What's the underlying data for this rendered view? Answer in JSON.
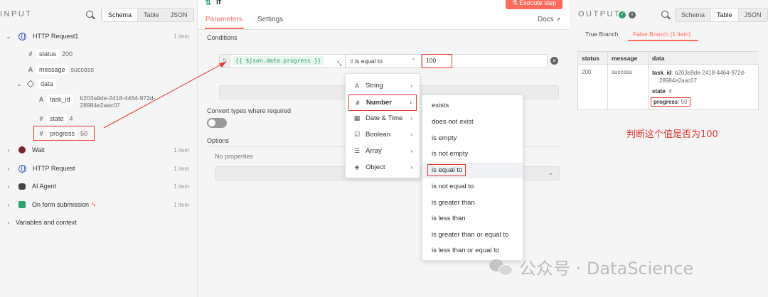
{
  "input": {
    "title": "INPUT",
    "view_tabs": [
      "Schema",
      "Table",
      "JSON"
    ],
    "active_view": "Schema",
    "nodes": [
      {
        "name": "HTTP Request1",
        "count": "1 item"
      },
      {
        "name": "Wait",
        "count": "1 item"
      },
      {
        "name": "HTTP Request",
        "count": "1 item"
      },
      {
        "name": "AI Agent",
        "count": "1 item"
      },
      {
        "name": "On form submission",
        "count": "1 item"
      }
    ],
    "fields": {
      "status": {
        "label": "status",
        "value": "200",
        "type_icon": "#"
      },
      "message": {
        "label": "message",
        "value": "success",
        "type_icon": "A"
      },
      "data": {
        "label": "data"
      },
      "task_id": {
        "label": "task_id",
        "value_line1": "b203a9de-2418-4464-972d-",
        "value_line2": "28984e2aac07",
        "type_icon": "A"
      },
      "state": {
        "label": "state",
        "value": "4",
        "type_icon": "#"
      },
      "progress": {
        "label": "progress",
        "value": "50",
        "type_icon": "#"
      }
    },
    "variables": "Variables and context"
  },
  "node": {
    "title": "If",
    "tabs": [
      "Parameters",
      "Settings"
    ],
    "active_tab": "Parameters",
    "execute_label": "Execute step",
    "docs_label": "Docs",
    "conditions_label": "Conditions",
    "fx_label": "fx",
    "expression": "{{ $json.data.progress }}",
    "operator": "is equal to",
    "compare_value": "100",
    "convert_label": "Convert types where required",
    "options_label": "Options",
    "no_properties": "No properties"
  },
  "type_menu": [
    {
      "icon": "A",
      "label": "String"
    },
    {
      "icon": "#",
      "label": "Number"
    },
    {
      "icon": "▦",
      "label": "Date & Time"
    },
    {
      "icon": "☑",
      "label": "Boolean"
    },
    {
      "icon": "☰",
      "label": "Array"
    },
    {
      "icon": "◈",
      "label": "Object"
    }
  ],
  "highlighted_type": "Number",
  "operator_menu": [
    "exists",
    "does not exist",
    "is empty",
    "is not empty",
    "is equal to",
    "is not equal to",
    "is greater than",
    "is less than",
    "is greater than or equal to",
    "is less than or equal to"
  ],
  "highlighted_operator": "is equal to",
  "output": {
    "title": "OUTPUT",
    "view_tabs": [
      "Schema",
      "Table",
      "JSON"
    ],
    "active_view": "Table",
    "branches": [
      "True Branch",
      "False Branch (1 item)"
    ],
    "active_branch": "False Branch (1 item)",
    "columns": [
      "status",
      "message",
      "data"
    ],
    "row": {
      "status": "200",
      "message": "success",
      "task_id_label": "task_id",
      "task_id_value_line1": ": b203a9de-2418-4464-972d-",
      "task_id_value_line2": "28984e2aac07",
      "state_label": "state",
      "state_value": ": 4",
      "progress_label": "progress",
      "progress_value": ": 50"
    }
  },
  "annotation": "判断这个值是否为100",
  "watermark": "公众号 · DataScience",
  "colors": {
    "accent": "#ff6d5a",
    "annotation": "#e53935",
    "success": "#2aa06b",
    "expression": "#27a064"
  }
}
